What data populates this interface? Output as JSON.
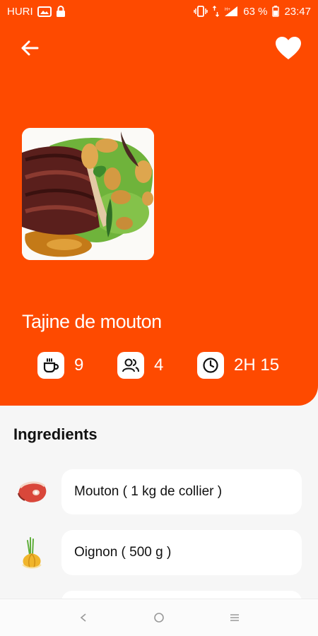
{
  "status_bar": {
    "carrier": "HURI",
    "battery": "63 %",
    "time": "23:47"
  },
  "header": {
    "back_icon": "arrow-left-icon",
    "favorite_icon": "heart-icon"
  },
  "recipe": {
    "title": "Tajine de mouton",
    "stats": [
      {
        "icon": "coffee-cup-icon",
        "value": "9"
      },
      {
        "icon": "users-icon",
        "value": "4"
      },
      {
        "icon": "clock-icon",
        "value": "2H 15"
      }
    ]
  },
  "ingredients": {
    "title": "Ingredients",
    "items": [
      {
        "icon": "meat-icon",
        "label": "Mouton ( 1 kg de collier )"
      },
      {
        "icon": "onion-icon",
        "label": "Oignon ( 500 g )"
      }
    ]
  },
  "colors": {
    "accent": "#fe4a00",
    "background": "#f6f6f6",
    "card": "#ffffff"
  }
}
